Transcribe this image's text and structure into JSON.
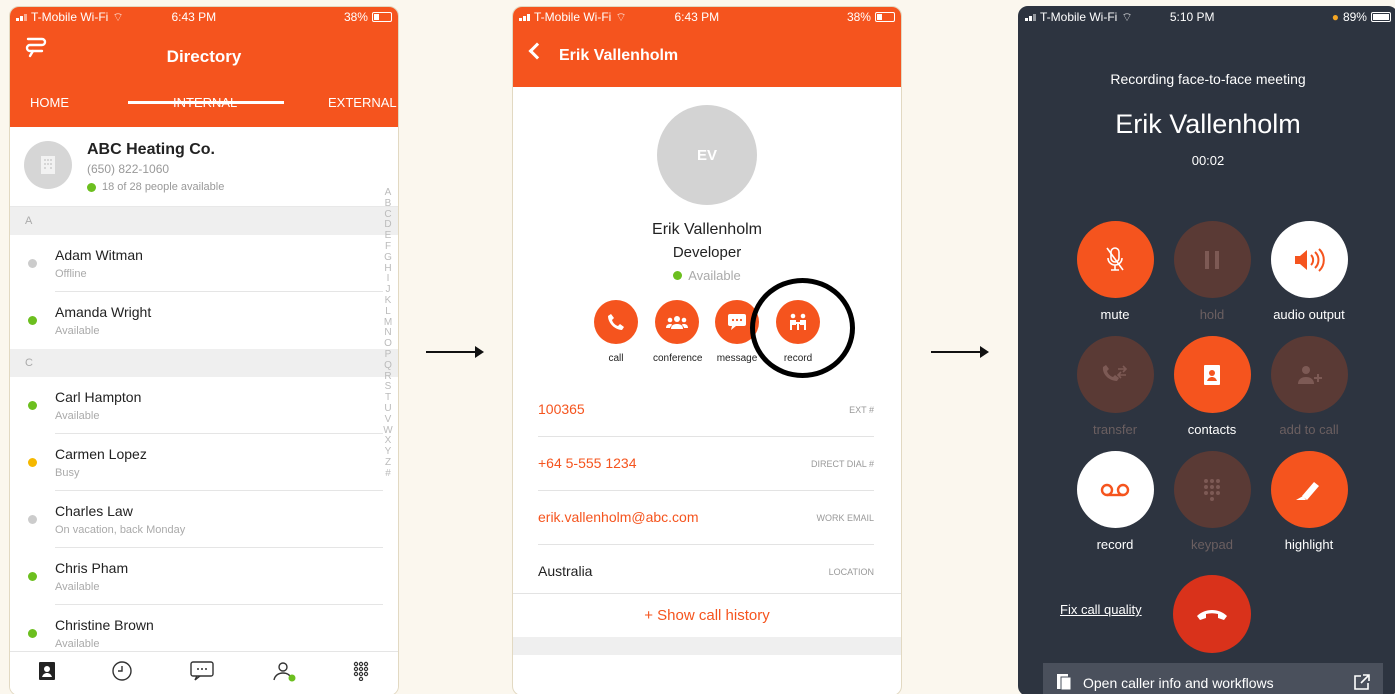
{
  "status_bar": {
    "carrier": "T-Mobile Wi-Fi",
    "time_a": "6:43 PM",
    "time_b": "5:10 PM",
    "battery_a": "38%",
    "battery_b": "89%"
  },
  "directory": {
    "title": "Directory",
    "tabs": [
      "HOME",
      "INTERNAL",
      "EXTERNAL"
    ],
    "company": {
      "name": "ABC Heating Co.",
      "phone": "(650) 822-1060",
      "availability": "18 of 28 people available"
    },
    "sections": [
      {
        "letter": "A",
        "contacts": [
          {
            "name": "Adam Witman",
            "status": "Offline",
            "color": "#cccccc"
          },
          {
            "name": "Amanda Wright",
            "status": "Available",
            "color": "#6cbf1f"
          }
        ]
      },
      {
        "letter": "C",
        "contacts": [
          {
            "name": "Carl Hampton",
            "status": "Available",
            "color": "#6cbf1f"
          },
          {
            "name": "Carmen Lopez",
            "status": "Busy",
            "color": "#f5b800"
          },
          {
            "name": "Charles Law",
            "status": "On vacation, back Monday",
            "color": "#cccccc"
          },
          {
            "name": "Chris Pham",
            "status": "Available",
            "color": "#6cbf1f"
          },
          {
            "name": "Christine Brown",
            "status": "Available",
            "color": "#6cbf1f"
          }
        ]
      }
    ],
    "alphabet": [
      "A",
      "B",
      "C",
      "D",
      "E",
      "F",
      "G",
      "H",
      "I",
      "J",
      "K",
      "L",
      "M",
      "N",
      "O",
      "P",
      "Q",
      "R",
      "S",
      "T",
      "U",
      "V",
      "W",
      "X",
      "Y",
      "Z",
      "#"
    ],
    "nav_icons": [
      "contacts-icon",
      "history-icon",
      "messages-icon",
      "user-status-icon",
      "dialpad-icon"
    ]
  },
  "profile": {
    "header_name": "Erik Vallenholm",
    "initials": "EV",
    "name": "Erik Vallenholm",
    "role": "Developer",
    "availability": "Available",
    "actions": [
      "call",
      "conference",
      "message",
      "record"
    ],
    "fields": [
      {
        "value": "100365",
        "label": "EXT #"
      },
      {
        "value": "+64 5-555 1234",
        "label": "DIRECT DIAL #"
      },
      {
        "value": "erik.vallenholm@abc.com",
        "label": "WORK EMAIL"
      },
      {
        "value": "Australia",
        "label": "LOCATION"
      }
    ],
    "history": "+   Show call history"
  },
  "call": {
    "subtitle": "Recording face-to-face meeting",
    "name": "Erik Vallenholm",
    "timer": "00:02",
    "buttons": [
      {
        "label": "mute",
        "style": "orange"
      },
      {
        "label": "hold",
        "style": "dim"
      },
      {
        "label": "audio output",
        "style": "white"
      },
      {
        "label": "transfer",
        "style": "dim"
      },
      {
        "label": "contacts",
        "style": "orange"
      },
      {
        "label": "add to call",
        "style": "dim"
      },
      {
        "label": "record",
        "style": "white"
      },
      {
        "label": "keypad",
        "style": "dim"
      },
      {
        "label": "highlight",
        "style": "orange"
      }
    ],
    "fix_quality": "Fix call quality",
    "footer": "Open caller info and workflows"
  }
}
